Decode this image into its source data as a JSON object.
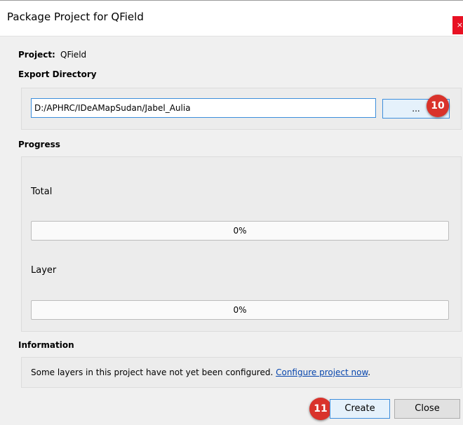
{
  "window": {
    "title": "Package Project for QField",
    "close_glyph": "×"
  },
  "project": {
    "label": "Project:",
    "value": "QField"
  },
  "export_directory": {
    "label": "Export Directory",
    "path": "D:/APHRC/IDeAMapSudan/Jabel_Aulia",
    "browse_label": "..."
  },
  "progress": {
    "label": "Progress",
    "total_label": "Total",
    "total_percent": 0,
    "total_text": "0%",
    "layer_label": "Layer",
    "layer_percent": 0,
    "layer_text": "0%"
  },
  "information": {
    "label": "Information",
    "message": "Some layers in this project have not yet been configured. ",
    "link_text": "Configure project now",
    "trailing": "."
  },
  "buttons": {
    "create_label": "Create",
    "close_label": "Close"
  },
  "badges": {
    "step_browse": "10",
    "step_create": "11"
  },
  "colors": {
    "badge": "#d9322b",
    "focus": "#3d8edc",
    "link": "#0645ad",
    "close": "#e81123"
  }
}
